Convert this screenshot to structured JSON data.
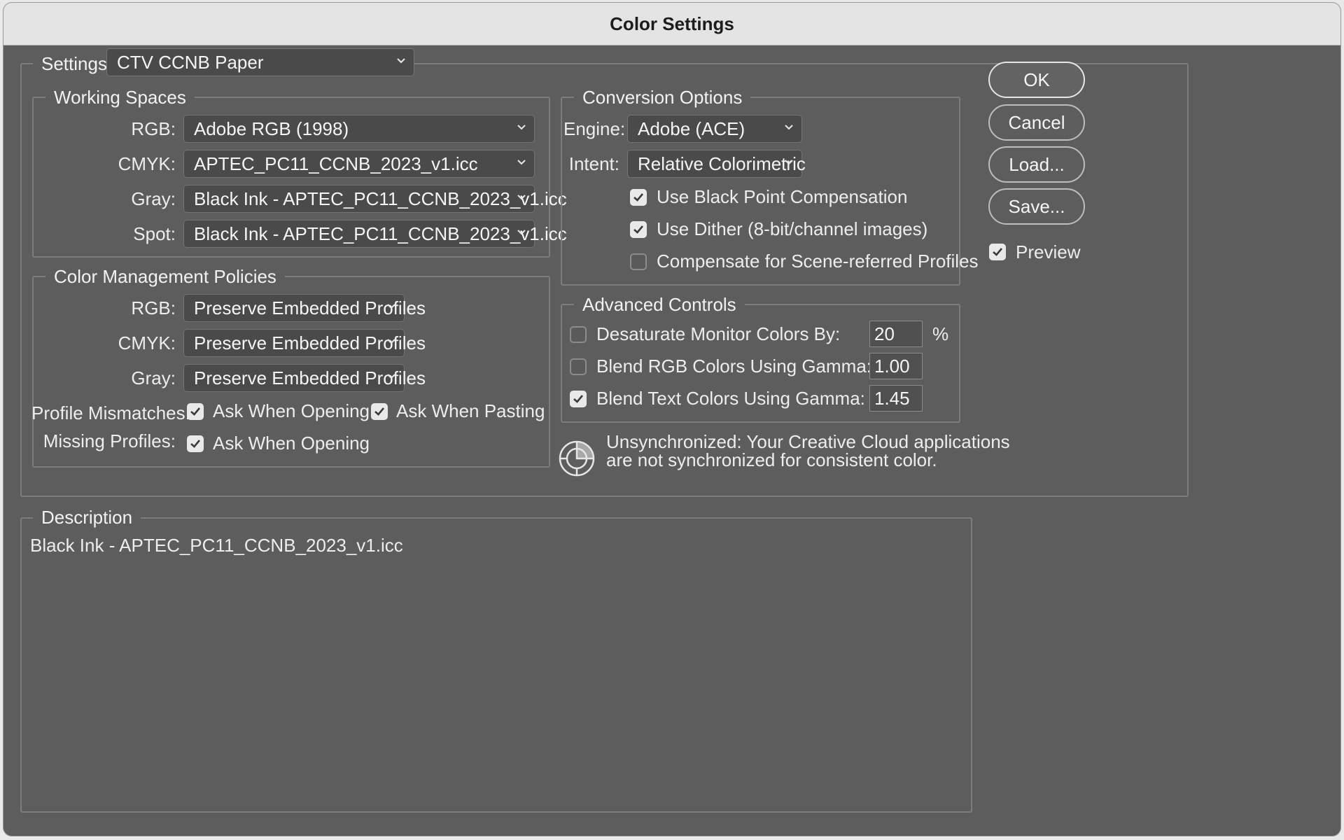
{
  "window": {
    "title": "Color Settings"
  },
  "settings": {
    "label": "Settings:",
    "value": "CTV CCNB Paper"
  },
  "working_spaces": {
    "legend": "Working Spaces",
    "rgb": {
      "label": "RGB:",
      "value": "Adobe RGB (1998)"
    },
    "cmyk": {
      "label": "CMYK:",
      "value": "APTEC_PC11_CCNB_2023_v1.icc"
    },
    "gray": {
      "label": "Gray:",
      "value": "Black Ink - APTEC_PC11_CCNB_2023_v1.icc"
    },
    "spot": {
      "label": "Spot:",
      "value": "Black Ink - APTEC_PC11_CCNB_2023_v1.icc"
    }
  },
  "policies": {
    "legend": "Color Management Policies",
    "rgb": {
      "label": "RGB:",
      "value": "Preserve Embedded Profiles"
    },
    "cmyk": {
      "label": "CMYK:",
      "value": "Preserve Embedded Profiles"
    },
    "gray": {
      "label": "Gray:",
      "value": "Preserve Embedded Profiles"
    },
    "profile_mismatches": {
      "label": "Profile Mismatches:",
      "ask_opening": {
        "label": "Ask When Opening",
        "checked": true
      },
      "ask_pasting": {
        "label": "Ask When Pasting",
        "checked": true
      }
    },
    "missing_profiles": {
      "label": "Missing Profiles:",
      "ask_opening": {
        "label": "Ask When Opening",
        "checked": true
      }
    }
  },
  "conversion": {
    "legend": "Conversion Options",
    "engine": {
      "label": "Engine:",
      "value": "Adobe (ACE)"
    },
    "intent": {
      "label": "Intent:",
      "value": "Relative Colorimetric"
    },
    "black_point": {
      "label": "Use Black Point Compensation",
      "checked": true
    },
    "dither": {
      "label": "Use Dither (8-bit/channel images)",
      "checked": true
    },
    "scene_referred": {
      "label": "Compensate for Scene-referred Profiles",
      "checked": false
    }
  },
  "advanced": {
    "legend": "Advanced Controls",
    "desaturate": {
      "label": "Desaturate Monitor Colors By:",
      "checked": false,
      "value": "20",
      "unit": "%"
    },
    "blend_rgb": {
      "label": "Blend RGB Colors Using Gamma:",
      "checked": false,
      "value": "1.00"
    },
    "blend_text": {
      "label": "Blend Text Colors Using Gamma:",
      "checked": true,
      "value": "1.45"
    }
  },
  "sync": {
    "icon": "color-sync-icon",
    "line1": "Unsynchronized: Your Creative Cloud applications",
    "line2": "are not synchronized for consistent color."
  },
  "description": {
    "legend": "Description",
    "text": "Black Ink - APTEC_PC11_CCNB_2023_v1.icc"
  },
  "buttons": {
    "ok": "OK",
    "cancel": "Cancel",
    "load": "Load...",
    "save": "Save..."
  },
  "preview": {
    "label": "Preview",
    "checked": true
  },
  "colors": {
    "panel": "#5d5d5d",
    "titlebar": "#e4e4e4",
    "frame": "#7d7d7d"
  }
}
